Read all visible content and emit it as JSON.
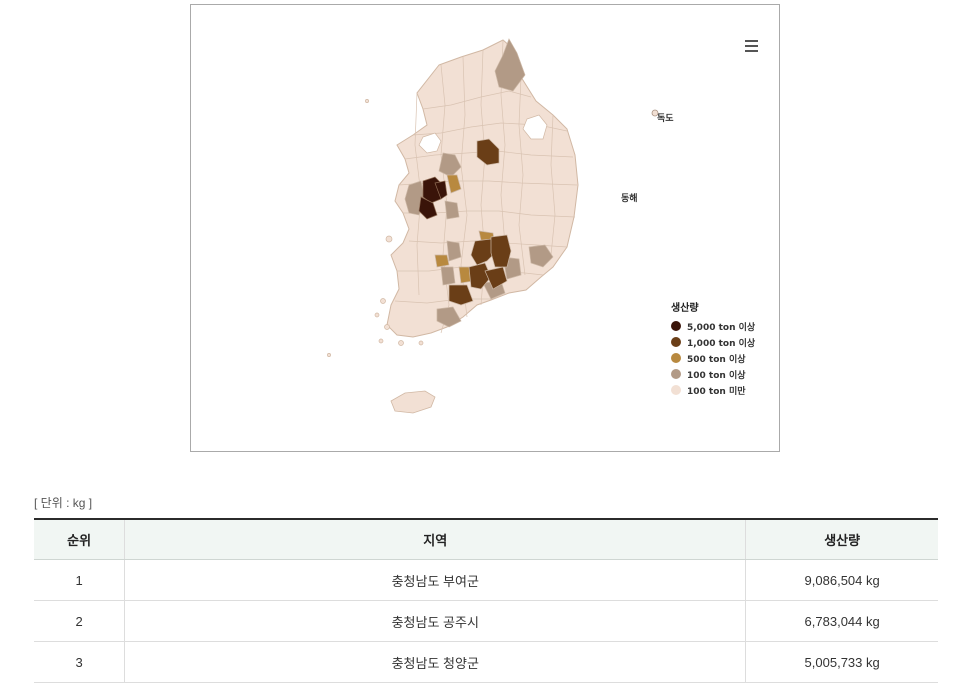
{
  "map": {
    "sea_labels": {
      "dokdo": "독도",
      "east_sea": "동해"
    },
    "legend": {
      "title": "생산량",
      "items": [
        {
          "label": "5,000 ton 이상",
          "color": "#3a1409"
        },
        {
          "label": "1,000 ton 이상",
          "color": "#6a3e17"
        },
        {
          "label": "500 ton 이상",
          "color": "#b8893f"
        },
        {
          "label": "100 ton 이상",
          "color": "#b29a86"
        },
        {
          "label": "100 ton 미만",
          "color": "#f2e0d4"
        }
      ]
    },
    "colors": {
      "region_fill": "#f2e0d4",
      "region_stroke": "#d1b8a4",
      "border": "#aaaaaa"
    }
  },
  "unit_note": "[ 단위 : kg ]",
  "table": {
    "headers": [
      "순위",
      "지역",
      "생산량"
    ],
    "rows": [
      {
        "rank": "1",
        "region": "충청남도 부여군",
        "amount": "9,086,504 kg"
      },
      {
        "rank": "2",
        "region": "충청남도 공주시",
        "amount": "6,783,044 kg"
      },
      {
        "rank": "3",
        "region": "충청남도 청양군",
        "amount": "5,005,733 kg"
      }
    ]
  }
}
